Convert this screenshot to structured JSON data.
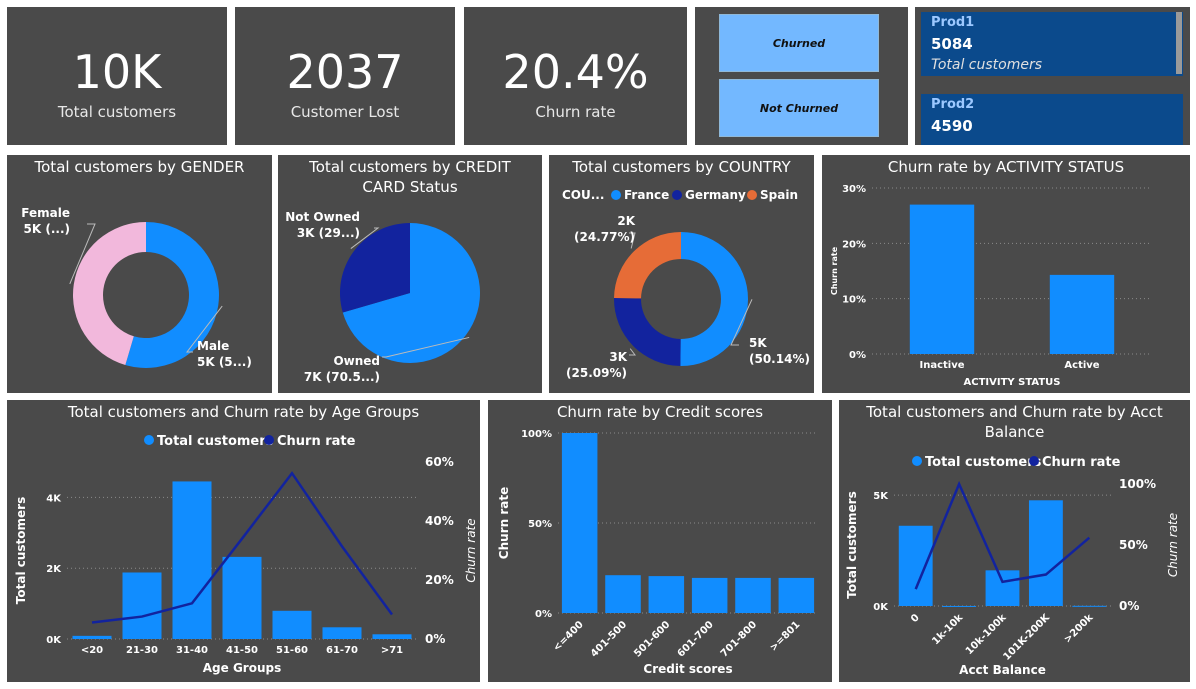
{
  "kpis": [
    {
      "value": "10K",
      "label": "Total customers"
    },
    {
      "value": "2037",
      "label": "Customer Lost"
    },
    {
      "value": "20.4%",
      "label": "Churn rate"
    }
  ],
  "slicer": {
    "options": [
      "Churned",
      "Not Churned"
    ]
  },
  "product_cards": [
    {
      "name": "Prod1",
      "value": "5084",
      "sublabel": "Total customers"
    },
    {
      "name": "Prod2",
      "value": "4590",
      "sublabel": ""
    }
  ],
  "colors": {
    "panel": "#4a4a4a",
    "accent": "#118dff",
    "dark_blue": "#12239e",
    "orange": "#e66c37",
    "pink": "#f2b8dc",
    "slicer": "#73b8ff",
    "card": "#0b4a8c",
    "grid": "#8a8a8a"
  },
  "chart_data": [
    {
      "id": "gender",
      "type": "pie",
      "donut": true,
      "title": "Total customers by GENDER",
      "slices": [
        {
          "name": "Male",
          "value": 5457,
          "label": "Male",
          "label2": "5K (5...)"
        },
        {
          "name": "Female",
          "value": 4543,
          "label": "Female",
          "label2": "5K (...)"
        }
      ]
    },
    {
      "id": "credit_card",
      "type": "pie",
      "title": "Total customers by CREDIT CARD Status",
      "slices": [
        {
          "name": "Owned",
          "value": 70.5,
          "label": "Owned",
          "label2": "7K (70.5...)"
        },
        {
          "name": "Not Owned",
          "value": 29.5,
          "label": "Not Owned",
          "label2": "3K (29...)"
        }
      ]
    },
    {
      "id": "country",
      "type": "pie",
      "donut": true,
      "title": "Total customers by COUNTRY",
      "legend_title": "COU...",
      "legend": [
        "France",
        "Germany",
        "Spain"
      ],
      "slices": [
        {
          "name": "France",
          "value": 50.14,
          "label": "5K",
          "label2": "(50.14%)"
        },
        {
          "name": "Germany",
          "value": 25.09,
          "label": "3K",
          "label2": "(25.09%)"
        },
        {
          "name": "Spain",
          "value": 24.77,
          "label": "2K",
          "label2": "(24.77%)"
        }
      ]
    },
    {
      "id": "activity",
      "type": "bar",
      "title": "Churn rate by ACTIVITY STATUS",
      "categories": [
        "Inactive",
        "Active"
      ],
      "values": [
        27,
        14.3
      ],
      "xlabel": "ACTIVITY STATUS",
      "ylabel": "Churn rate",
      "ylim": [
        0,
        30
      ],
      "yticks": [
        "0%",
        "10%",
        "20%",
        "30%"
      ]
    },
    {
      "id": "age",
      "type": "bar",
      "title": "Total customers and Churn rate by Age Groups",
      "legend": [
        "Total customers",
        "Churn rate"
      ],
      "categories": [
        "<20",
        "21-30",
        "31-40",
        "41-50",
        "51-60",
        "61-70",
        ">71"
      ],
      "series": [
        {
          "name": "Total customers",
          "values": [
            89,
            1879,
            4451,
            2320,
            797,
            331,
            133
          ]
        },
        {
          "name": "Churn rate",
          "values": [
            5.6,
            7.6,
            12.1,
            34,
            56.2,
            31.4,
            8.3
          ]
        }
      ],
      "xlabel": "Age Groups",
      "ylabel": "Total customers",
      "y2label": "Churn rate",
      "ylim": [
        0,
        5000
      ],
      "y2lim": [
        0,
        60
      ],
      "yticks": [
        "0K",
        "2K",
        "4K"
      ],
      "y2ticks": [
        "0%",
        "20%",
        "40%",
        "60%"
      ]
    },
    {
      "id": "credit_scores",
      "type": "bar",
      "title": "Churn rate by Credit scores",
      "categories": [
        "<=400",
        "401-500",
        "501-600",
        "601-700",
        "701-800",
        ">=801"
      ],
      "values": [
        100,
        21,
        20.5,
        19.5,
        19.5,
        19.5
      ],
      "xlabel": "Credit scores",
      "ylabel": "Churn rate",
      "ylim": [
        0,
        100
      ],
      "yticks": [
        "0%",
        "50%",
        "100%"
      ]
    },
    {
      "id": "balance",
      "type": "bar",
      "title": "Total customers and Churn rate by Acct Balance",
      "legend": [
        "Total customers",
        "Churn rate"
      ],
      "categories": [
        "0",
        "1k-10k",
        "10k-100k",
        "101K-200K",
        ">200k"
      ],
      "series": [
        {
          "name": "Total customers",
          "values": [
            3617,
            2,
            1608,
            4765,
            8
          ]
        },
        {
          "name": "Churn rate",
          "values": [
            13.8,
            100,
            19.8,
            25.8,
            56
          ]
        }
      ],
      "xlabel": "Acct Balance",
      "ylabel": "Total customers",
      "y2label": "Churn rate",
      "ylim": [
        0,
        5500
      ],
      "y2lim": [
        0,
        100
      ],
      "yticks": [
        "0K",
        "5K"
      ],
      "y2ticks": [
        "0%",
        "50%",
        "100%"
      ]
    }
  ]
}
